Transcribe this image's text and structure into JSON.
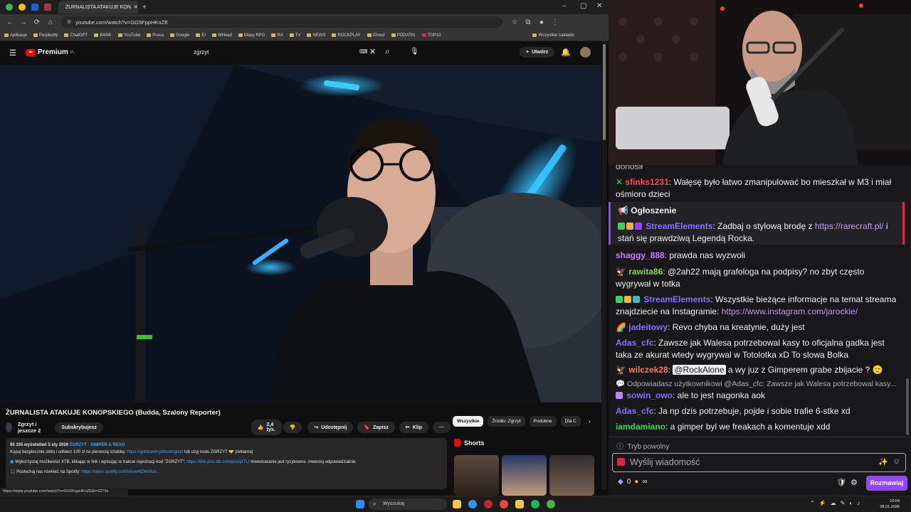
{
  "browser": {
    "tab_title": "ŻURNALISTA ATAKUJE KON",
    "url": "youtube.com/watch?v=GG5FppHKnZE",
    "bookmarks": [
      "Aplikacje",
      "Perplexity",
      "ChatGPT",
      "BANK",
      "YouTube",
      "Praca",
      "Google",
      "EI",
      "WHead",
      "Mapy RPG",
      "RA",
      "TV",
      "NEWS",
      "ROCKPLAY",
      "iCloud",
      "PODATKI",
      "TOP10"
    ],
    "all_bookmarks_label": "Wszystkie zakładki",
    "status_url": "https://www.youtube.com/watch?v=GG5FppHKnZE&t=3276s"
  },
  "youtube": {
    "logo_text": "Premium",
    "logo_sup": "PL",
    "search_value": "zgrzyt",
    "create_label": "Utwórz",
    "video_title": "ŻURNALISTA ATAKUJE KONOPSKIEGO (Budda, Szalony Reporter)",
    "channel_name": "Zgrzyt i jeszcze 2",
    "subscribe_label": "Subskrybujesz",
    "likes": "2,4 tys.",
    "share_label": "Udostępnij",
    "save_label": "Zapisz",
    "clip_label": "Klip",
    "views_line": "95 335 wyświetleń  5 sty 2026",
    "hashtags": "ZGRZYT · GIMPER & REVO",
    "desc_line1_a": "Kupuj bezpiecznie złoto i odbierz 100 zł na pierwszą sztabkę: ",
    "desc_line1_link": "https://goldsaver.pl/kod/zgrzyt",
    "desc_line1_b": " lub użyj kodu ZGRZYT 🤝 [reklama]",
    "desc_line2_a": "Wykorzystaj możliwości XTB, klikając w link i wpisując w trakcie rejestracji kod \"ZGRZYT\": ",
    "desc_line2_link": "https://link-pso.xtb.com/pso/jXTLf",
    "desc_line2_b": " Inwestowanie jest ryzykowne. Inwestuj odpowiedzialnie.",
    "desc_line3_a": "Posłuchaj nas również na Spotify: ",
    "desc_line3_link": "https://open.spotify.com/show/6ZMo9ze...",
    "filter_chips": [
      "Wszystkie",
      "Źródło: Zgrzyt",
      "Podobne",
      "Dla C"
    ],
    "shorts_label": "Shorts"
  },
  "chat": {
    "top_fragment": "donosił",
    "messages": [
      {
        "user": "sfinks1231",
        "color": "#ff4a4a",
        "text": ": Wałęsę było łatwo zmanipulować bo mieszkał w M3 i miał ośmioro dzieci"
      },
      {
        "user": "StreamElements",
        "color": "#8c6cff",
        "text": ": Zadbaj o stylową brodę z ",
        "link": "https://rarecraft.pl/",
        "text2": " i stań się prawdziwą Legendą Rocka."
      },
      {
        "user": "shaggy_888",
        "color": "#c77dff",
        "text": ": prawda nas wyzwoli"
      },
      {
        "user": "rawita86",
        "color": "#8fd14f",
        "text": ": @2ah22 mają grafologa na podpisy? no zbyt często wygrywał w totka"
      },
      {
        "user": "StreamElements",
        "color": "#8c6cff",
        "text": ": Wszystkie bieżące informacje na temat streama znajdziecie na Instagramie: ",
        "link": "https://www.instagram.com/jarockie/"
      },
      {
        "user": "jadeitowy",
        "color": "#8c6cff",
        "text": ": Revo chyba na kreatynie, duży jest"
      },
      {
        "user": "Adas_cfc",
        "color": "#8c6cff",
        "text": ": Zawsze jak Walesa potrzebowal kasy to oficjalna gadka jest taka ze akurat wtedy wygrywal w Totolotka xD To slowa Bolka"
      },
      {
        "user": "wilczek28",
        "color": "#ff7a45",
        "mention": "@RockAlone",
        "text": " a wy juz z Gimperem grabe zbijacie ?"
      },
      {
        "user": "sowin_owo",
        "color": "#8c6cff",
        "text": ": ale to jest nagonka aok"
      },
      {
        "user": "Adas_cfc",
        "color": "#8c6cff",
        "text": ": Ja np dzis potrzebuje, pojde i sobie trafie 6-stke xd"
      },
      {
        "user": "iamdamiano",
        "color": "#3ad35a",
        "text": ": a gimper byl we freakach a komentuje xdd"
      }
    ],
    "announcement_label": "Ogłoszenie",
    "reply_hint": "Odpowiadasz użytkownikowi @Adas_cfc: Zawsze jak Walesa potrzebowal kasy...",
    "slow_mode_label": "Tryb powolny",
    "input_placeholder": "Wyślij wiadomość",
    "points": "0",
    "send_label": "Rozmawiaj"
  },
  "taskbar": {
    "search_placeholder": "Wyszukaj",
    "time": "10:04",
    "date": "08.01.2026"
  }
}
